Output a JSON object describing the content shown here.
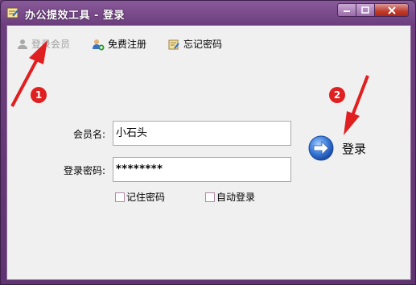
{
  "window": {
    "title": "办公提效工具 - 登录"
  },
  "toolbar": {
    "member_login": "登录会员",
    "free_register": "免费注册",
    "forgot_password": "忘记密码"
  },
  "form": {
    "username_label": "会员名:",
    "username_value": "小石头",
    "password_label": "登录密码:",
    "password_value": "********",
    "remember_label": "记住密码",
    "auto_login_label": "自动登录"
  },
  "login": {
    "label": "登录"
  },
  "annotations": {
    "first": "1",
    "second": "2"
  },
  "colors": {
    "frame": "#6c3e7d",
    "client": "#f0f0f0",
    "annotation": "#e02020"
  }
}
